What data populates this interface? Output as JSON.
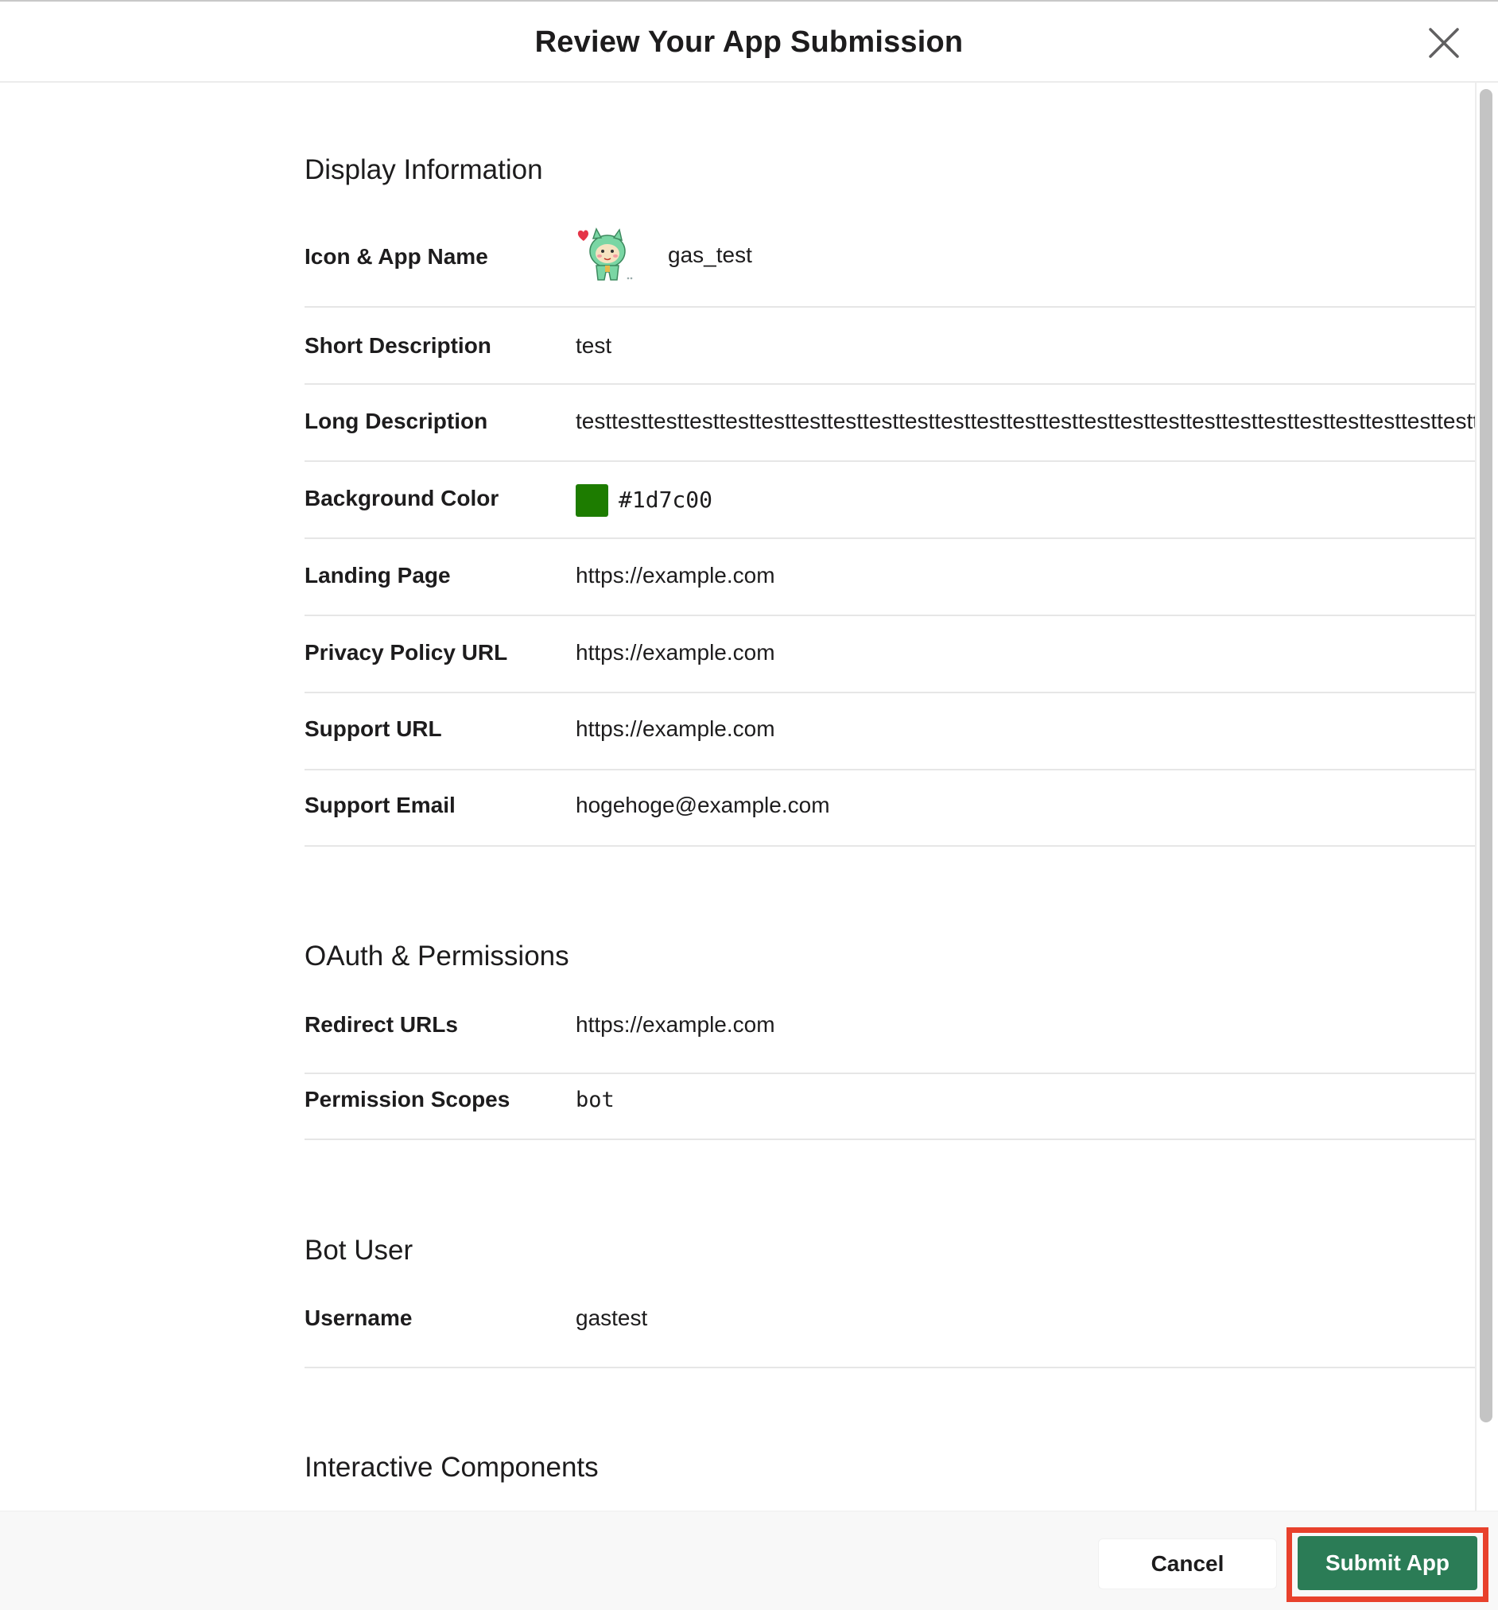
{
  "modal": {
    "title": "Review Your App Submission",
    "close_icon": "close-icon"
  },
  "sections": {
    "display": {
      "heading": "Display Information",
      "icon_app_name_label": "Icon & App Name",
      "app_name": "gas_test",
      "app_icon": "app-icon",
      "short_description_label": "Short Description",
      "short_description": "test",
      "long_description_label": "Long Description",
      "long_description": "testtesttesttesttesttesttesttesttesttesttesttesttesttesttesttesttesttesttesttesttesttesttesttesttesttesttestte",
      "background_color_label": "Background Color",
      "background_color": "#1d7c00",
      "landing_page_label": "Landing Page",
      "landing_page": "https://example.com",
      "privacy_policy_label": "Privacy Policy URL",
      "privacy_policy": "https://example.com",
      "support_url_label": "Support URL",
      "support_url": "https://example.com",
      "support_email_label": "Support Email",
      "support_email": "hogehoge@example.com"
    },
    "oauth": {
      "heading": "OAuth & Permissions",
      "redirect_urls_label": "Redirect URLs",
      "redirect_urls": "https://example.com",
      "permission_scopes_label": "Permission Scopes",
      "permission_scopes": "bot"
    },
    "bot_user": {
      "heading": "Bot User",
      "username_label": "Username",
      "username": "gastest"
    },
    "interactive": {
      "heading": "Interactive Components"
    }
  },
  "footer": {
    "cancel_label": "Cancel",
    "submit_label": "Submit App"
  },
  "colors": {
    "submit_button": "#2b7c56",
    "highlight": "#e8412c",
    "swatch": "#1d7c00"
  }
}
